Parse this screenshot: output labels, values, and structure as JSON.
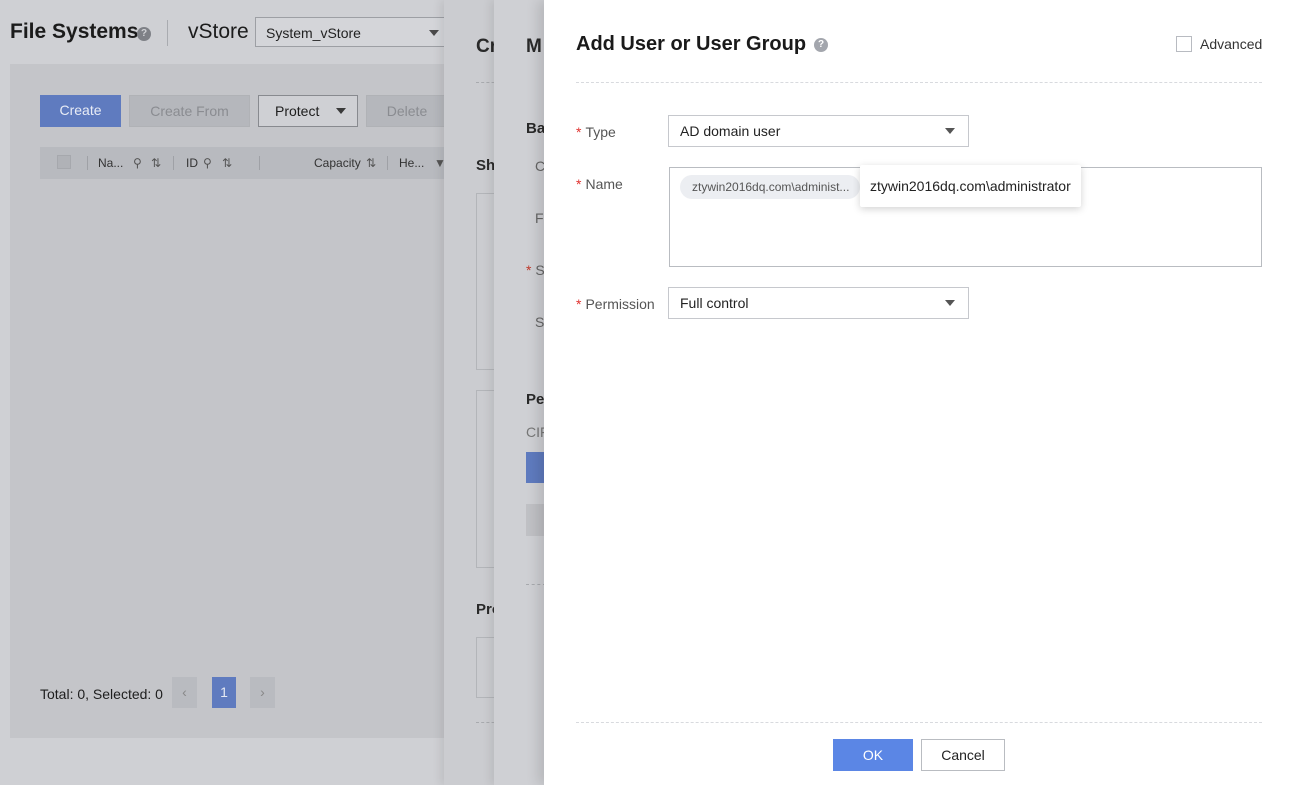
{
  "background": {
    "title": "File Systems",
    "vstore_label": "vStore",
    "vstore_value": "System_vStore",
    "buttons": {
      "create": "Create",
      "create_from": "Create From",
      "protect": "Protect",
      "delete": "Delete"
    },
    "table_columns": [
      "Na...",
      "ID",
      "Capacity",
      "He..."
    ],
    "footer": "Total: 0, Selected: 0",
    "page": "1"
  },
  "drawer_behind_1": {
    "title_fragment": "Cr",
    "section_share": "Sh",
    "section_protect": "Pro"
  },
  "drawer_behind_2": {
    "title_fragment": "M",
    "section_basic": "Ba",
    "row_c": "C",
    "row_fi": "Fi",
    "row_s": "S",
    "row_s2": "S",
    "section_perm": "Pe",
    "cifs": "CIF"
  },
  "dialog": {
    "title": "Add User or User Group",
    "advanced_label": "Advanced",
    "type_label": "Type",
    "type_value": "AD domain user",
    "name_label": "Name",
    "name_tag": "ztywin2016dq.com\\administ...",
    "name_tooltip": "ztywin2016dq.com\\administrator",
    "permission_label": "Permission",
    "permission_value": "Full control",
    "ok_label": "OK",
    "cancel_label": "Cancel",
    "required_mark": "*",
    "help_glyph": "?"
  },
  "colors": {
    "primary": "#5b86e5",
    "required": "#e0322f"
  }
}
